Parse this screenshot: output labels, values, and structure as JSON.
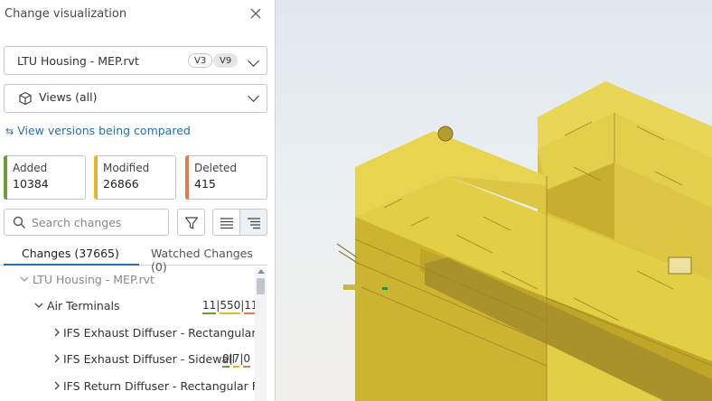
{
  "panel": {
    "title": "Change visualization",
    "close_icon": "close-icon"
  },
  "file_select": {
    "value": "LTU Housing - MEP.rvt",
    "version_a": "V3",
    "version_b": "V9"
  },
  "views_select": {
    "value": "Views (all)",
    "icon": "cube-icon"
  },
  "compare_link": {
    "icon": "swap-icon",
    "label": "View versions being compared"
  },
  "stats": [
    {
      "label": "Added",
      "value": "10384",
      "color": "#6f9b3a"
    },
    {
      "label": "Modified",
      "value": "26866",
      "color": "#e4b82a"
    },
    {
      "label": "Deleted",
      "value": "415",
      "color": "#e07a4f"
    }
  ],
  "search": {
    "placeholder": "Search changes",
    "value": ""
  },
  "tabs": [
    {
      "label": "Changes (37665)",
      "active": true
    },
    {
      "label": "Watched Changes (0)",
      "active": false
    }
  ],
  "tree": [
    {
      "label": "LTU Housing - MEP.rvt",
      "expanded": true,
      "level": 0
    },
    {
      "label": "Air Terminals",
      "expanded": true,
      "level": 1,
      "counts": [
        "11",
        "550",
        "11"
      ]
    },
    {
      "label": "IFS Exhaust Diffuser - Rectangular ...",
      "expanded": false,
      "level": 2
    },
    {
      "label": "IFS Exhaust Diffuser - Sidewall",
      "expanded": false,
      "level": 2,
      "counts": [
        "0",
        "7",
        "0"
      ]
    },
    {
      "label": "IFS Return Diffuser - Rectangular F...",
      "expanded": false,
      "level": 2
    }
  ],
  "colors": {
    "accent": "#2a6fa8",
    "added": "#6f9b3a",
    "modified": "#e4b82a",
    "deleted": "#e07a4f",
    "model": "#e3cf45"
  }
}
